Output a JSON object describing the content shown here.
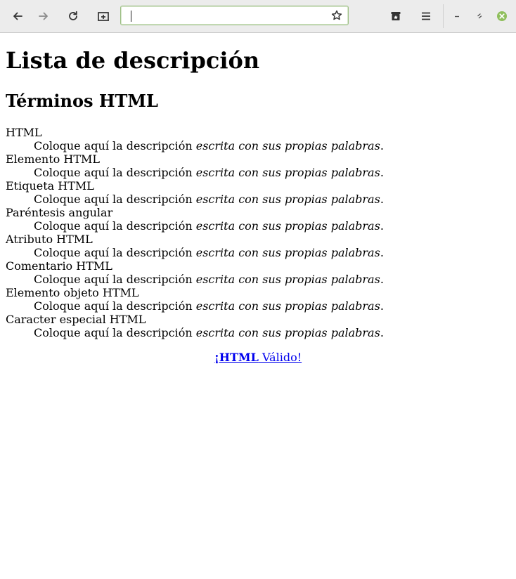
{
  "browser": {
    "url_value": "",
    "icons": {
      "back": "arrow-left-icon",
      "forward": "arrow-right-icon",
      "reload": "reload-icon",
      "new_tab": "new-tab-icon",
      "bookmark": "star-icon",
      "library": "library-icon",
      "menu": "hamburger-menu-icon",
      "minimize": "minimize-icon",
      "restore": "restore-icon",
      "close": "close-icon"
    },
    "colors": {
      "close_button": "#8fbf5c",
      "urlbar_border": "#9cbf83"
    }
  },
  "page": {
    "title": "Lista de descripción",
    "subtitle": "Términos HTML",
    "terms": [
      {
        "term": "HTML",
        "desc_plain": "Coloque aquí la descripción ",
        "desc_italic": "escrita con sus propias palabras",
        "desc_end": "."
      },
      {
        "term": "Elemento HTML",
        "desc_plain": "Coloque aquí la descripción ",
        "desc_italic": "escrita con sus propias palabras",
        "desc_end": "."
      },
      {
        "term": "Etiqueta HTML",
        "desc_plain": "Coloque aquí la descripción ",
        "desc_italic": "escrita con sus propias palabras",
        "desc_end": "."
      },
      {
        "term": "Paréntesis angular",
        "desc_plain": "Coloque aquí la descripción ",
        "desc_italic": "escrita con sus propias palabras",
        "desc_end": "."
      },
      {
        "term": "Atributo HTML",
        "desc_plain": "Coloque aquí la descripción ",
        "desc_italic": "escrita con sus propias palabras",
        "desc_end": "."
      },
      {
        "term": "Comentario HTML",
        "desc_plain": "Coloque aquí la descripción ",
        "desc_italic": "escrita con sus propias palabras",
        "desc_end": "."
      },
      {
        "term": "Elemento objeto HTML",
        "desc_plain": "Coloque aquí la descripción ",
        "desc_italic": "escrita con sus propias palabras",
        "desc_end": "."
      },
      {
        "term": "Caracter especial HTML",
        "desc_plain": "Coloque aquí la descripción ",
        "desc_italic": "escrita con sus propias palabras",
        "desc_end": "."
      }
    ],
    "valid_link": {
      "bold": "¡HTML",
      "rest": " Válido!"
    }
  }
}
